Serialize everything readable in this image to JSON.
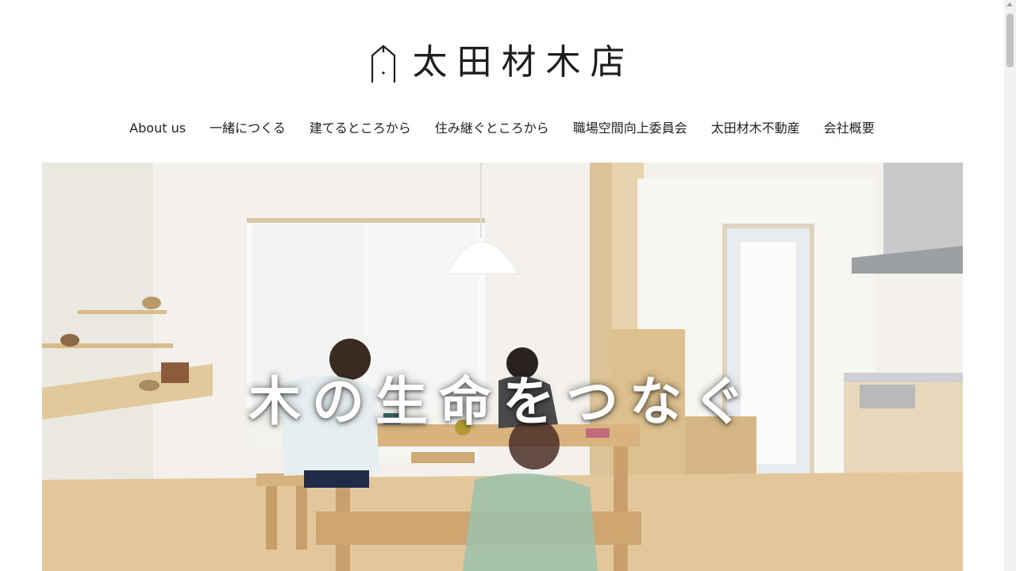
{
  "header": {
    "logo_text": "太田材木店"
  },
  "nav": {
    "items": [
      {
        "label": "About us"
      },
      {
        "label": "一緒につくる"
      },
      {
        "label": "建てるところから"
      },
      {
        "label": "住み継ぐところから"
      },
      {
        "label": "職場空間向上委員会"
      },
      {
        "label": "太田材木不動産"
      },
      {
        "label": "会社概要"
      }
    ]
  },
  "hero": {
    "caption": "木の生命をつなぐ"
  },
  "colors": {
    "text": "#222222",
    "background": "#ffffff",
    "caption": "#ffffff"
  }
}
